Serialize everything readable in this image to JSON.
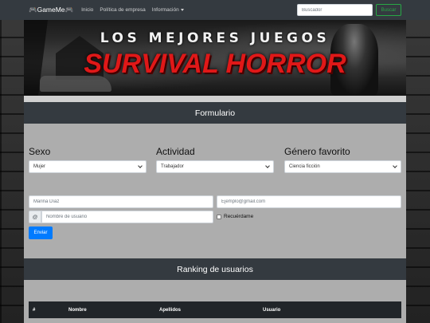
{
  "navbar": {
    "brand": "🎮GameMe🎮",
    "links": [
      "Inicio",
      "Política de empresa",
      "Información"
    ],
    "search_placeholder": "Buscador",
    "search_button": "Buscar"
  },
  "banner": {
    "line1": "LOS MEJORES JUEGOS",
    "line2": "SURVIVAL HORROR"
  },
  "form": {
    "title": "Formulario",
    "sexo": {
      "label": "Sexo",
      "selected": "Mujer"
    },
    "actividad": {
      "label": "Actividad",
      "selected": "Trabajador"
    },
    "genero": {
      "label": "Género favorito",
      "selected": "Ciencia ficción"
    },
    "name_placeholder": "Marina Díaz",
    "email_placeholder": "Ejemplo@gmail.com",
    "at_symbol": "@",
    "username_placeholder": "Nombre de usuario",
    "remember_label": "Recuérdame",
    "submit_label": "Enviar"
  },
  "ranking": {
    "title": "Ranking de usuarios",
    "columns": [
      "#",
      "Nombre",
      "Apellidos",
      "Usuario"
    ]
  },
  "colors": {
    "navbar": "#343a40",
    "primary": "#007bff",
    "success": "#28a745",
    "panel": "#adadad",
    "banner_red": "#e01818"
  }
}
